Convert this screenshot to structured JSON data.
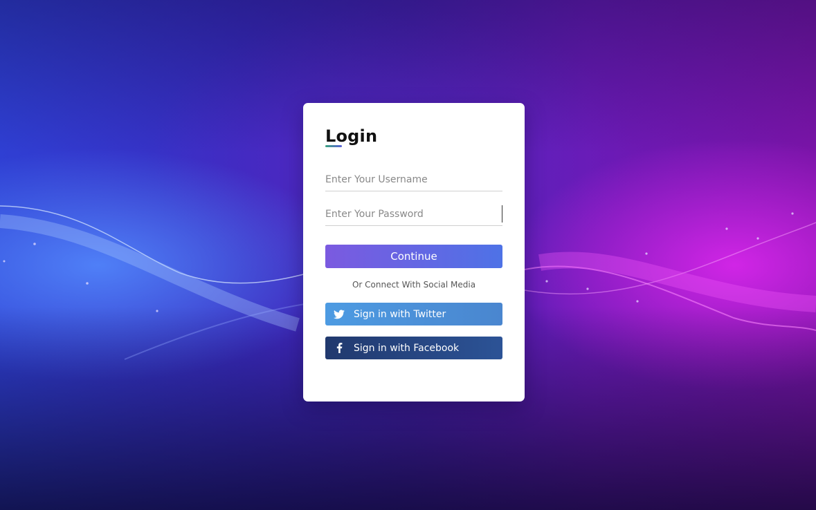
{
  "login": {
    "title": "Login",
    "username_placeholder": "Enter Your Username",
    "password_placeholder": "Enter Your Password",
    "continue_label": "Continue",
    "social_caption": "Or Connect With Social Media",
    "twitter_label": "Sign in with Twitter",
    "facebook_label": "Sign in with Facebook"
  },
  "icons": {
    "twitter": "twitter-bird-icon",
    "facebook": "facebook-f-icon"
  },
  "colors": {
    "continue_gradient": [
      "#7b5ae0",
      "#4e72e6"
    ],
    "twitter": "#4a90d9",
    "facebook": "#23407a"
  }
}
